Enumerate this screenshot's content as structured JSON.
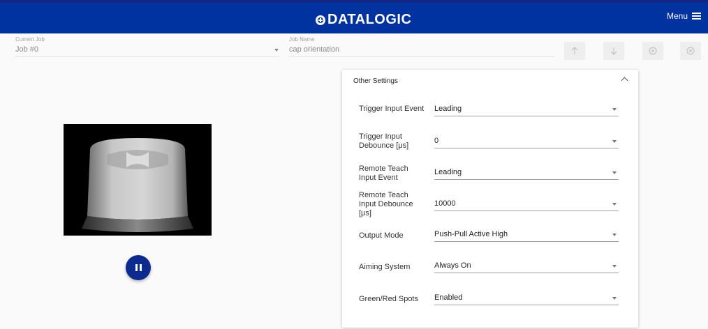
{
  "header": {
    "logo_text": "DATALOGIC",
    "menu_label": "Menu"
  },
  "jobbar": {
    "current_job_label": "Current Job",
    "current_job_value": "Job #0",
    "job_name_label": "Job Name",
    "job_name_value": "cap orientation",
    "buttons": [
      "arrow-up-icon",
      "arrow-down-icon",
      "add-circle-icon",
      "cancel-circle-icon"
    ]
  },
  "panel": {
    "title": "Other Settings",
    "settings": [
      {
        "label": "Trigger Input Event",
        "value": "Leading"
      },
      {
        "label": "Trigger Input Debounce [μs]",
        "value": "0"
      },
      {
        "label": "Remote Teach Input Event",
        "value": "Leading"
      },
      {
        "label": "Remote Teach Input Debounce [μs]",
        "value": "10000"
      },
      {
        "label": "Output Mode",
        "value": "Push-Pull Active High"
      },
      {
        "label": "Aiming System",
        "value": "Always On"
      },
      {
        "label": "Green/Red Spots",
        "value": "Enabled"
      }
    ]
  },
  "colors": {
    "brand": "#0033a0",
    "pause_button": "#0d2a8f"
  }
}
